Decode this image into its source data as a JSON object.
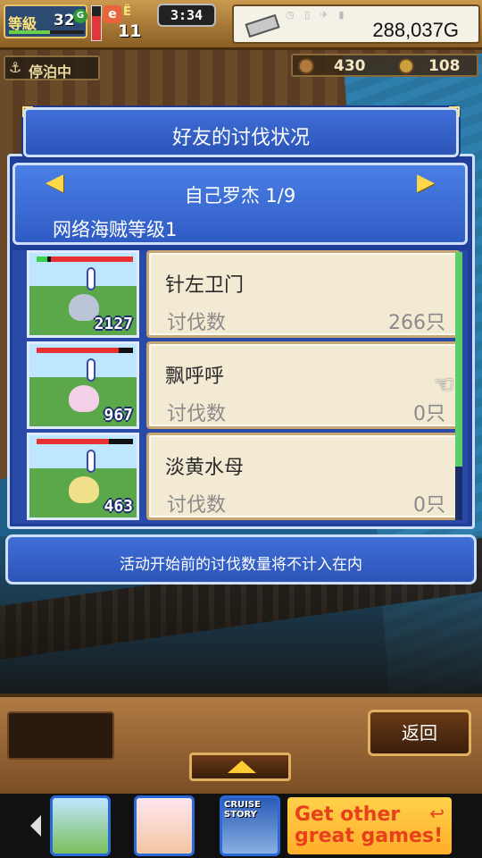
{
  "hud": {
    "level_label": "等級",
    "level_value": "32",
    "energy_label": "Ë",
    "energy_value": "11",
    "time": "3:34",
    "gold": "288,037G"
  },
  "status": {
    "docked_label": "停泊中",
    "resource_1": "430",
    "resource_2": "108"
  },
  "dialog": {
    "title": "好友的讨伐状况",
    "player_name": "自己罗杰 1/9",
    "pirate_level": "网络海贼等级1",
    "prev_arrow": "◀",
    "next_arrow": "▶",
    "entries": [
      {
        "monster_count": "2127",
        "name": "针左卫门",
        "kill_label": "讨伐数",
        "kills": "266只",
        "hp": 0.85,
        "color": "#bcc4d8"
      },
      {
        "monster_count": "967",
        "name": "飘呼呼",
        "kill_label": "讨伐数",
        "kills": "0只",
        "hp": 0.85,
        "color": "#f4d0e8"
      },
      {
        "monster_count": "463",
        "name": "淡黄水母",
        "kill_label": "讨伐数",
        "kills": "0只",
        "hp": 0.75,
        "color": "#f0e08a"
      }
    ],
    "notice": "活动开始前的讨伐数量将不计入在内"
  },
  "buttons": {
    "back": "返回"
  },
  "ad": {
    "cruise_text": "CRUISE STORY",
    "get_games": "Get other great games!"
  }
}
